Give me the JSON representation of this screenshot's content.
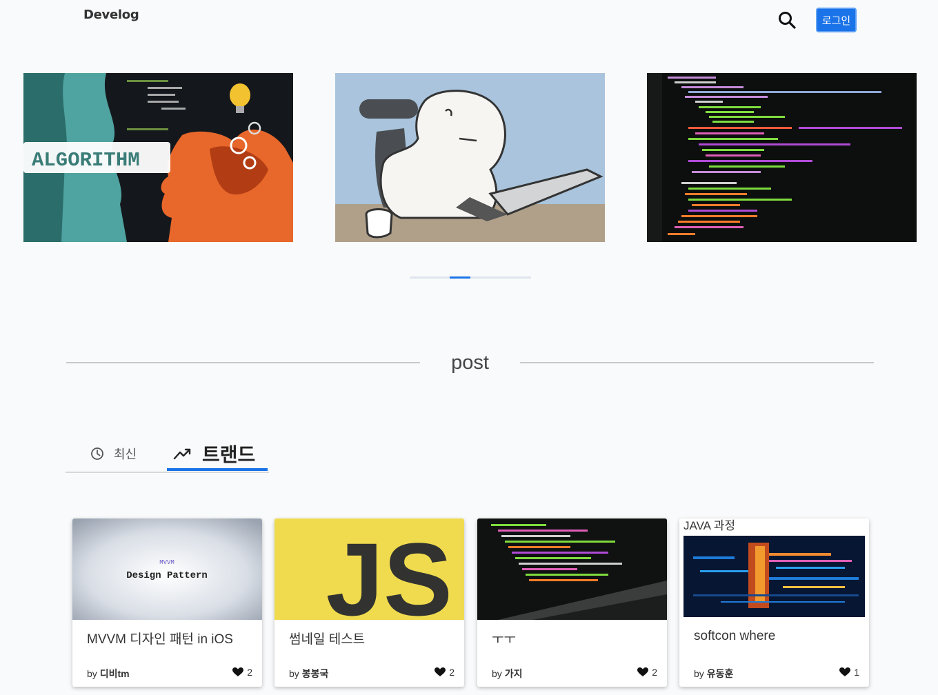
{
  "header": {
    "logo": "Develog",
    "login_label": "로그인"
  },
  "slider": {
    "slides": [
      {
        "name": "algorithm-banner",
        "text": "ALGORITHM"
      },
      {
        "name": "laptop-character-illustration"
      },
      {
        "name": "code-editor-screenshot"
      }
    ],
    "active_index": 1
  },
  "section": {
    "title": "post"
  },
  "tabs": [
    {
      "label": "최신",
      "icon": "clock-icon",
      "active": false
    },
    {
      "label": "트랜드",
      "icon": "trending-icon",
      "active": true
    }
  ],
  "posts": [
    {
      "thumb_line1": "MVVM",
      "thumb_line2": "Design Pattern",
      "title": "MVVM 디자인 패턴 in iOS",
      "by": "by",
      "author": "디비tm",
      "likes": "2"
    },
    {
      "thumb_text": "JS",
      "title": "썸네일 테스트",
      "by": "by",
      "author": "봉봉국",
      "likes": "2"
    },
    {
      "title": "ㅜㅜ",
      "by": "by",
      "author": "가지",
      "likes": "2"
    },
    {
      "thumb_caption": "JAVA 과정",
      "title": "softcon where",
      "by": "by",
      "author": "유동훈",
      "likes": "1"
    }
  ],
  "colors": {
    "accent": "#1a73e8",
    "background": "#f9fafb"
  }
}
